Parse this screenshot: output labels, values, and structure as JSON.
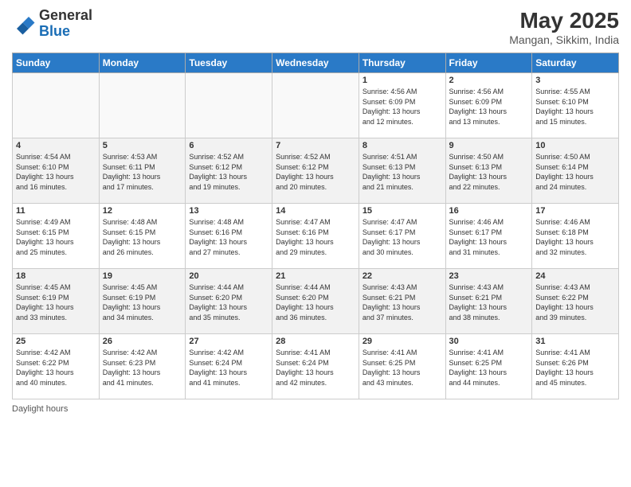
{
  "header": {
    "logo_general": "General",
    "logo_blue": "Blue",
    "main_title": "May 2025",
    "sub_title": "Mangan, Sikkim, India"
  },
  "columns": [
    "Sunday",
    "Monday",
    "Tuesday",
    "Wednesday",
    "Thursday",
    "Friday",
    "Saturday"
  ],
  "weeks": [
    [
      {
        "day": "",
        "info": "",
        "empty": true
      },
      {
        "day": "",
        "info": "",
        "empty": true
      },
      {
        "day": "",
        "info": "",
        "empty": true
      },
      {
        "day": "",
        "info": "",
        "empty": true
      },
      {
        "day": "1",
        "info": "Sunrise: 4:56 AM\nSunset: 6:09 PM\nDaylight: 13 hours\nand 12 minutes."
      },
      {
        "day": "2",
        "info": "Sunrise: 4:56 AM\nSunset: 6:09 PM\nDaylight: 13 hours\nand 13 minutes."
      },
      {
        "day": "3",
        "info": "Sunrise: 4:55 AM\nSunset: 6:10 PM\nDaylight: 13 hours\nand 15 minutes."
      }
    ],
    [
      {
        "day": "4",
        "info": "Sunrise: 4:54 AM\nSunset: 6:10 PM\nDaylight: 13 hours\nand 16 minutes.",
        "gray": true
      },
      {
        "day": "5",
        "info": "Sunrise: 4:53 AM\nSunset: 6:11 PM\nDaylight: 13 hours\nand 17 minutes.",
        "gray": true
      },
      {
        "day": "6",
        "info": "Sunrise: 4:52 AM\nSunset: 6:12 PM\nDaylight: 13 hours\nand 19 minutes.",
        "gray": true
      },
      {
        "day": "7",
        "info": "Sunrise: 4:52 AM\nSunset: 6:12 PM\nDaylight: 13 hours\nand 20 minutes.",
        "gray": true
      },
      {
        "day": "8",
        "info": "Sunrise: 4:51 AM\nSunset: 6:13 PM\nDaylight: 13 hours\nand 21 minutes.",
        "gray": true
      },
      {
        "day": "9",
        "info": "Sunrise: 4:50 AM\nSunset: 6:13 PM\nDaylight: 13 hours\nand 22 minutes.",
        "gray": true
      },
      {
        "day": "10",
        "info": "Sunrise: 4:50 AM\nSunset: 6:14 PM\nDaylight: 13 hours\nand 24 minutes.",
        "gray": true
      }
    ],
    [
      {
        "day": "11",
        "info": "Sunrise: 4:49 AM\nSunset: 6:15 PM\nDaylight: 13 hours\nand 25 minutes."
      },
      {
        "day": "12",
        "info": "Sunrise: 4:48 AM\nSunset: 6:15 PM\nDaylight: 13 hours\nand 26 minutes."
      },
      {
        "day": "13",
        "info": "Sunrise: 4:48 AM\nSunset: 6:16 PM\nDaylight: 13 hours\nand 27 minutes."
      },
      {
        "day": "14",
        "info": "Sunrise: 4:47 AM\nSunset: 6:16 PM\nDaylight: 13 hours\nand 29 minutes."
      },
      {
        "day": "15",
        "info": "Sunrise: 4:47 AM\nSunset: 6:17 PM\nDaylight: 13 hours\nand 30 minutes."
      },
      {
        "day": "16",
        "info": "Sunrise: 4:46 AM\nSunset: 6:17 PM\nDaylight: 13 hours\nand 31 minutes."
      },
      {
        "day": "17",
        "info": "Sunrise: 4:46 AM\nSunset: 6:18 PM\nDaylight: 13 hours\nand 32 minutes."
      }
    ],
    [
      {
        "day": "18",
        "info": "Sunrise: 4:45 AM\nSunset: 6:19 PM\nDaylight: 13 hours\nand 33 minutes.",
        "gray": true
      },
      {
        "day": "19",
        "info": "Sunrise: 4:45 AM\nSunset: 6:19 PM\nDaylight: 13 hours\nand 34 minutes.",
        "gray": true
      },
      {
        "day": "20",
        "info": "Sunrise: 4:44 AM\nSunset: 6:20 PM\nDaylight: 13 hours\nand 35 minutes.",
        "gray": true
      },
      {
        "day": "21",
        "info": "Sunrise: 4:44 AM\nSunset: 6:20 PM\nDaylight: 13 hours\nand 36 minutes.",
        "gray": true
      },
      {
        "day": "22",
        "info": "Sunrise: 4:43 AM\nSunset: 6:21 PM\nDaylight: 13 hours\nand 37 minutes.",
        "gray": true
      },
      {
        "day": "23",
        "info": "Sunrise: 4:43 AM\nSunset: 6:21 PM\nDaylight: 13 hours\nand 38 minutes.",
        "gray": true
      },
      {
        "day": "24",
        "info": "Sunrise: 4:43 AM\nSunset: 6:22 PM\nDaylight: 13 hours\nand 39 minutes.",
        "gray": true
      }
    ],
    [
      {
        "day": "25",
        "info": "Sunrise: 4:42 AM\nSunset: 6:22 PM\nDaylight: 13 hours\nand 40 minutes."
      },
      {
        "day": "26",
        "info": "Sunrise: 4:42 AM\nSunset: 6:23 PM\nDaylight: 13 hours\nand 41 minutes."
      },
      {
        "day": "27",
        "info": "Sunrise: 4:42 AM\nSunset: 6:24 PM\nDaylight: 13 hours\nand 41 minutes."
      },
      {
        "day": "28",
        "info": "Sunrise: 4:41 AM\nSunset: 6:24 PM\nDaylight: 13 hours\nand 42 minutes."
      },
      {
        "day": "29",
        "info": "Sunrise: 4:41 AM\nSunset: 6:25 PM\nDaylight: 13 hours\nand 43 minutes."
      },
      {
        "day": "30",
        "info": "Sunrise: 4:41 AM\nSunset: 6:25 PM\nDaylight: 13 hours\nand 44 minutes."
      },
      {
        "day": "31",
        "info": "Sunrise: 4:41 AM\nSunset: 6:26 PM\nDaylight: 13 hours\nand 45 minutes."
      }
    ]
  ],
  "footer": {
    "daylight_label": "Daylight hours"
  }
}
